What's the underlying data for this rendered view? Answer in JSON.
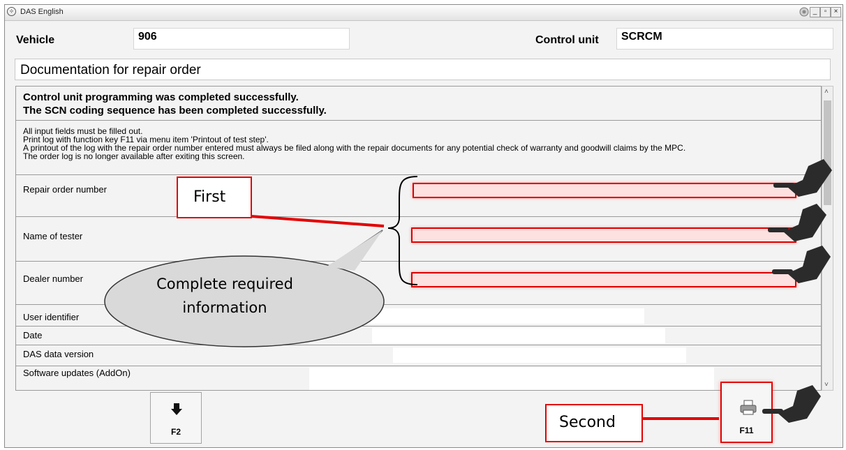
{
  "window": {
    "title": "DAS English"
  },
  "header": {
    "vehicle_label": "Vehicle",
    "vehicle_value": "906",
    "control_unit_label": "Control unit",
    "control_unit_value": "SCRCM"
  },
  "documentation_title": "Documentation for repair order",
  "messages": {
    "line1": "Control unit programming was completed successfully.",
    "line2": "The SCN coding sequence has been completed successfully."
  },
  "instructions": [
    "All input fields must be filled out.",
    "Print log with function key F11 via menu item 'Printout of test step'.",
    "A printout of the log with the repair order number entered must always be filed along with the repair documents for any potential check of warranty and goodwill claims by the MPC.",
    "The order log is no longer available after exiting this screen."
  ],
  "fields": {
    "repair_order_number": "Repair order number",
    "name_of_tester": "Name of tester",
    "dealer_number": "Dealer number",
    "user_identifier": "User identifier",
    "date": "Date",
    "das_data_version": "DAS data version",
    "software_updates": "Software updates (AddOn)"
  },
  "function_keys": {
    "f2": "F2",
    "f11": "F11"
  },
  "annotations": {
    "first": "First",
    "second": "Second",
    "bubble_line1": "Complete required",
    "bubble_line2": "information"
  },
  "colors": {
    "highlight_red": "#e00000",
    "field_pink": "#fde0e0",
    "bubble_gray": "#d9d9d9"
  }
}
